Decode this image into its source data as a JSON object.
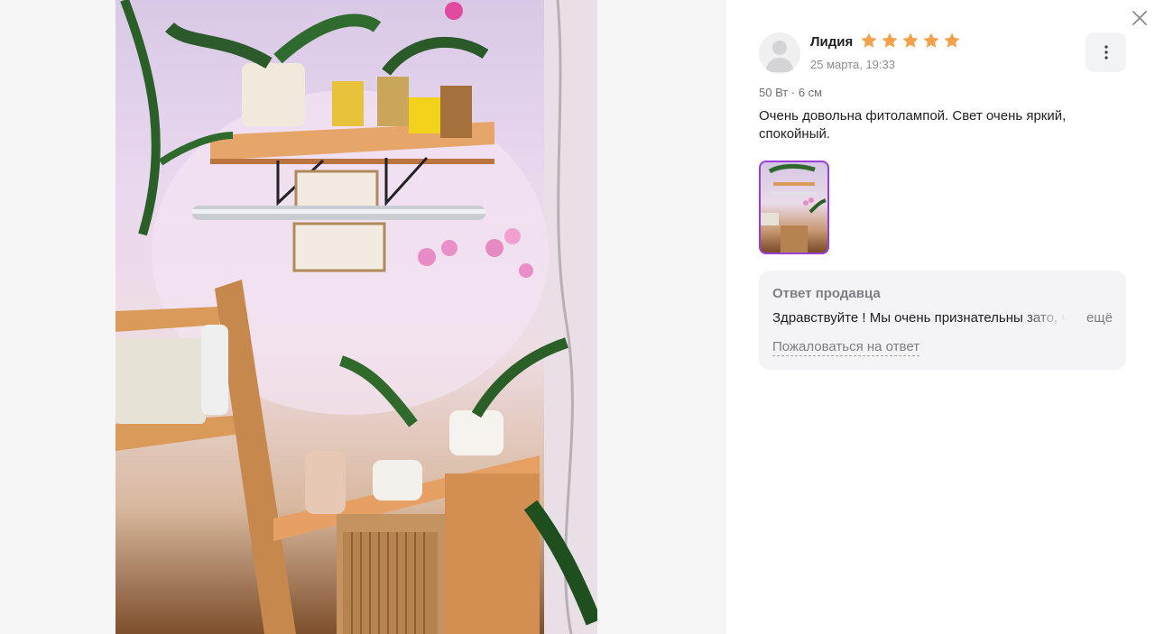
{
  "review": {
    "author": "Лидия",
    "rating": 5,
    "max_rating": 5,
    "date": "25 марта, 19:33",
    "variant": "50 Вт · 6 см",
    "text": "Очень довольна фитолампой. Свет очень яркий, спокойный."
  },
  "seller_reply": {
    "title": "Ответ продавца",
    "text": "Здравствуйте ! Мы очень признательны зато, что",
    "more_label": "ещё",
    "complain_label": "Пожаловаться на ответ"
  },
  "colors": {
    "star": "#f5a04a",
    "thumb_border": "#9a3fd6",
    "reply_bg": "#f4f4f6"
  },
  "icons": {
    "close": "close-icon",
    "menu": "more-vertical-icon",
    "avatar": "user-placeholder-icon",
    "star": "star-icon"
  }
}
